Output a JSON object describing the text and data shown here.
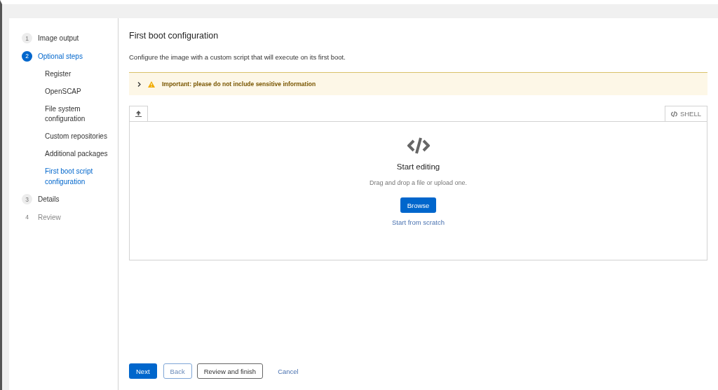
{
  "wizard_nav": [
    {
      "number": "1",
      "label": "Image output",
      "selected": false,
      "disabled": false
    },
    {
      "number": "2",
      "label": "Optional steps",
      "selected": true,
      "disabled": false,
      "children": [
        {
          "label": "Register",
          "selected": false
        },
        {
          "label": "OpenSCAP",
          "selected": false
        },
        {
          "label": "File system configuration",
          "selected": false
        },
        {
          "label": "Custom repositories",
          "selected": false
        },
        {
          "label": "Additional packages",
          "selected": false
        },
        {
          "label": "First boot script configuration",
          "selected": true
        }
      ]
    },
    {
      "number": "3",
      "label": "Details",
      "selected": false,
      "disabled": false
    },
    {
      "number": "4",
      "label": "Review",
      "selected": false,
      "disabled": true
    }
  ],
  "title": "First boot configuration",
  "description": "Configure the image with a custom script that will execute on its first boot.",
  "alert": {
    "text": "Important: please do not include sensitive information",
    "expanded": false
  },
  "editor": {
    "language": "SHELL",
    "empty_title": "Start editing",
    "empty_text": "Drag and drop a file or upload one.",
    "browse": "Browse",
    "scratch": "Start from scratch"
  },
  "footer": {
    "next": "Next",
    "back": "Back",
    "review": "Review and finish",
    "cancel": "Cancel"
  }
}
